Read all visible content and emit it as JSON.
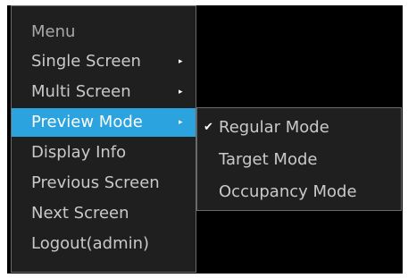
{
  "menu": {
    "title": "Menu",
    "items": [
      {
        "label": "Single Screen",
        "arrow": "▸"
      },
      {
        "label": "Multi Screen",
        "arrow": "▸"
      },
      {
        "label": "Preview Mode",
        "arrow": "▸"
      },
      {
        "label": "Display Info"
      },
      {
        "label": "Previous Screen"
      },
      {
        "label": "Next Screen"
      },
      {
        "label": "Logout(admin)"
      }
    ]
  },
  "submenu": {
    "items": [
      {
        "label": "Regular Mode",
        "check": "✔"
      },
      {
        "label": "Target Mode"
      },
      {
        "label": "Occupancy Mode"
      }
    ]
  },
  "colors": {
    "accent": "#2aa3de",
    "menu_bg": "#1f1f1f",
    "border": "#6a6a6a",
    "text": "#c9c9c9"
  }
}
